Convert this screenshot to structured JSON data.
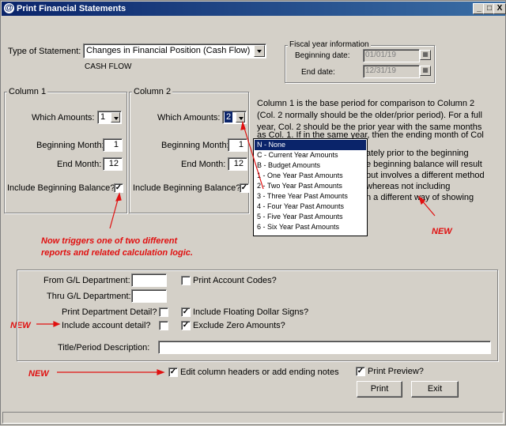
{
  "window": {
    "title": "Print Financial Statements",
    "app_icon": "@",
    "controls": [
      "_",
      "□",
      "X"
    ]
  },
  "statement": {
    "type_label": "Type of Statement:",
    "type_value": "Changes in Financial Position (Cash Flow)",
    "subtype": "CASH FLOW"
  },
  "fiscal": {
    "title": "Fiscal year information",
    "beginning_label": "Beginning date:",
    "beginning_value": "01/01/19",
    "end_label": "End date:",
    "end_value": "12/31/19"
  },
  "column1": {
    "title": "Column 1",
    "which_label": "Which Amounts:",
    "which_value": "1",
    "begin_month_label": "Beginning Month:",
    "begin_month_value": "1",
    "end_month_label": "End Month:",
    "end_month_value": "12",
    "include_label": "Include Beginning Balance?",
    "include_checked": "✓"
  },
  "column2": {
    "title": "Column 2",
    "which_label": "Which Amounts:",
    "which_value": "2",
    "begin_month_label": "Beginning Month:",
    "begin_month_value": "1",
    "end_month_label": "End Month:",
    "end_month_value": "12",
    "include_label": "Include Beginning Balance?",
    "include_checked": "✓"
  },
  "help_text": {
    "lines": [
      "Column 1 is the base period for comparison to Column 2",
      "(Col.  2 normally should be the older/prior period).   For a full",
      "year, Col. 2 should be the prior year with the same months",
      "as Col. 1.  If in the same year, then the ending month of Col",
      "ately prior to the beginning",
      "e beginning balance will result",
      "but involves a different method",
      "whereas not including",
      "n a different way of showing"
    ]
  },
  "amounts_dropdown": {
    "items": [
      "N - None",
      "C - Current Year Amounts",
      "B - Budget Amounts",
      "1 - One Year Past Amounts",
      "2 - Two Year Past Amounts",
      "3 - Three Year Past Amounts",
      "4 - Four Year Past Amounts",
      "5 - Five Year Past Amounts",
      "6 - Six Year Past Amounts"
    ],
    "selected_index": 0
  },
  "annotations": {
    "new_top": "NEW",
    "triggers_line1": "Now triggers one of two different",
    "triggers_line2": "reports and related calculation logic.",
    "new_account": "NEW",
    "new_edit": "NEW"
  },
  "options": {
    "from_dept_label": "From G/L Department:",
    "from_dept_value": "",
    "thru_dept_label": "Thru G/L Department:",
    "thru_dept_value": "",
    "print_dept_label": "Print Department Detail?",
    "print_dept_checked": "",
    "include_account_label": "Include account detail?",
    "include_account_checked": "",
    "print_codes_label": "Print Account Codes?",
    "print_codes_checked": "",
    "floating_label": "Include Floating Dollar Signs?",
    "floating_checked": "✓",
    "exclude_zero_label": "Exclude Zero Amounts?",
    "exclude_zero_checked": "✓",
    "title_label": "Title/Period Description:",
    "title_value": ""
  },
  "footer": {
    "edit_headers_label": "Edit column headers or add ending notes",
    "edit_headers_checked": "✓",
    "print_preview_label": "Print Preview?",
    "print_preview_checked": "✓",
    "print_button": "Print",
    "exit_button": "Exit"
  },
  "colors": {
    "annotation": "#e01010",
    "title_bar": "#0a246a",
    "selection": "#0a246a"
  }
}
